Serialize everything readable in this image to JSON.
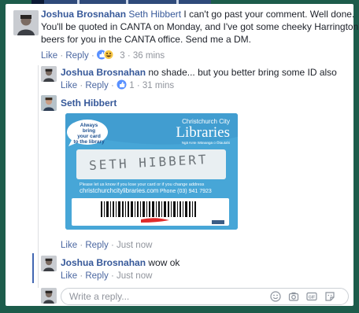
{
  "comments": {
    "c1": {
      "author": "Joshua Brosnahan",
      "mention": "Seth Hibbert",
      "line1": " I can't go past your comment. Well done.",
      "line2": "You'll be quoted in CANTA on Monday, and I've got some cheeky Harrington's",
      "line3": "beers for you in the CANTA office. Send me a DM.",
      "like": "Like",
      "reply": "Reply",
      "reactions": "3",
      "time": "36 mins"
    },
    "c2": {
      "author": "Joshua Brosnahan",
      "text": " no shade... but you better bring some ID also",
      "like": "Like",
      "reply": "Reply",
      "reactions": "1",
      "time": "31 mins"
    },
    "c3": {
      "author": "Seth Hibbert",
      "like": "Like",
      "reply": "Reply",
      "time": "Just now"
    },
    "c4": {
      "author": "Joshua Brosnahan",
      "text": " wow ok",
      "like": "Like",
      "reply": "Reply",
      "time": "Just now"
    },
    "sep": "·"
  },
  "library_card": {
    "badge_line1": "Always bring",
    "badge_line2": "your card",
    "badge_line3": "to the library",
    "org_line1": "Christchurch City",
    "org_line2": "Libraries",
    "org_line3": "Ngā Kete Wānanga o Ōtautahi",
    "name_written": "SETH HIBBERT",
    "notice": "Please let us know if you lose your card or if you change address",
    "website": "christchurchcitylibraries.com",
    "phone": "Phone (03) 941 7923",
    "colors": {
      "card": "#47a6d7",
      "name_strip": "#e9eff2",
      "redaction": "#e02a2a"
    }
  },
  "reply_box": {
    "placeholder": "Write a reply..."
  },
  "colors": {
    "link": "#365899",
    "meta": "#90949c",
    "border": "#1d5c4b"
  }
}
